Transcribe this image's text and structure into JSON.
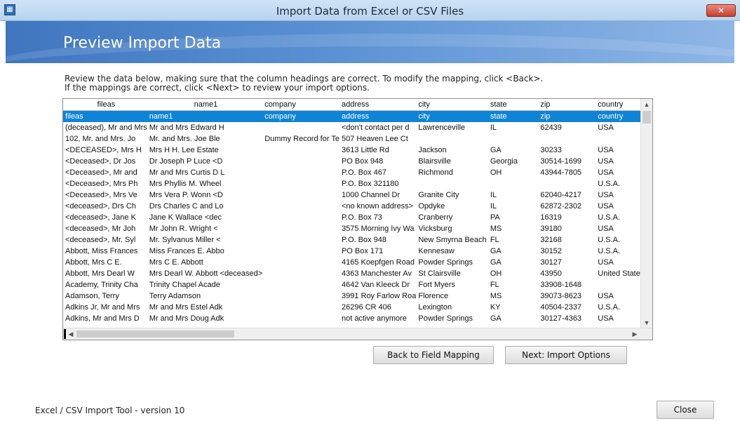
{
  "window": {
    "title": "Import Data from Excel or CSV Files",
    "close_symbol": "✕"
  },
  "banner": {
    "title": "Preview Import Data"
  },
  "instructions": {
    "line1": "Review the data below, making sure that the column headings are correct.  To modify the mapping, click <Back>.",
    "line2": "If the mappings are correct, click <Next> to review your import options."
  },
  "grid": {
    "headers": [
      "fileas",
      "name1",
      "company",
      "address",
      "city",
      "state",
      "zip",
      "country"
    ],
    "rows": [
      [
        "fileas",
        "name1",
        "company",
        "address",
        "city",
        "state",
        "zip",
        "country"
      ],
      [
        "(deceased), Mr and Mrs",
        "Mr and Mrs Edward H",
        "",
        "<don't contact per d",
        "Lawrenceville",
        "IL",
        "62439",
        "USA"
      ],
      [
        "102, Mr. and Mrs. Jo",
        "Mr. and Mrs. Joe Ble",
        "Dummy Record for Te",
        "507 Heaven Lee Ct",
        "",
        "",
        "",
        ""
      ],
      [
        "<DECEASED>, Mrs H",
        "Mrs H H. Lee Estate",
        "",
        "3613 Little Rd",
        "Jackson",
        "GA",
        "30233",
        "USA"
      ],
      [
        "<Deceased>, Dr Jos",
        "Dr Joseph P Luce <D",
        "",
        "PO Box 948",
        "Blairsville",
        "Georgia",
        "30514-1699",
        "USA"
      ],
      [
        "<Deceased>, Mr and",
        "Mr and Mrs Curtis D L",
        "",
        "P.O. Box 467",
        "Richmond",
        "OH",
        "43944-7805",
        "USA"
      ],
      [
        "<Deceased>, Mrs Ph",
        "Mrs Phyllis M. Wheel",
        "",
        "P.O. Box 321180",
        "",
        "",
        "",
        "U.S.A."
      ],
      [
        "<Deceased>, Mrs Ve",
        "Mrs Vera P. Wonn <D",
        "",
        "1000 Channel Dr",
        "Granite City",
        "IL",
        "62040-4217",
        "USA"
      ],
      [
        "<deceased>, Drs Ch",
        "Drs Charles C and Lo",
        "",
        "<no known address>",
        "Opdyke",
        "IL",
        "62872-2302",
        "USA"
      ],
      [
        "<deceased>, Jane K",
        "Jane K Wallace <dec",
        "",
        "P.O. Box 73",
        "Cranberry",
        "PA",
        "16319",
        "U.S.A."
      ],
      [
        "<deceased>, Mr Joh",
        "Mr John R. Wright <",
        "",
        "3575 Morning Ivy Wa",
        "Vicksburg",
        "MS",
        "39180",
        "USA"
      ],
      [
        "<deceased>, Mr. Syl",
        "Mr. Sylvanus Miller <",
        "",
        "P.O. Box 948",
        "New Smyrna Beach",
        "FL",
        "32168",
        "U.S.A."
      ],
      [
        "Abbott, Miss Frances",
        "Miss Frances E. Abbo",
        "",
        "PO Box 171",
        "Kennesaw",
        "GA",
        "30152",
        "U.S.A."
      ],
      [
        "Abbott, Mrs C E.",
        "Mrs C E. Abbott",
        "",
        "4165 Koepfgen Road",
        "Powder Springs",
        "GA",
        "30127",
        "USA"
      ],
      [
        "Abbott, Mrs Dearl W",
        "Mrs Dearl W. Abbott <deceased>",
        "",
        "4363 Manchester Av",
        "St Clairsville",
        "OH",
        "43950",
        "United States"
      ],
      [
        "Academy, Trinity Cha",
        "Trinity Chapel Acade",
        "",
        "4642 Van Kleeck Dr",
        "Fort Myers",
        "FL",
        "33908-1648",
        ""
      ],
      [
        "Adamson, Terry",
        "Terry Adamson",
        "",
        "3991 Roy Farlow Roa",
        "Florence",
        "MS",
        "39073-8623",
        "USA"
      ],
      [
        "Adkins Jr, Mr and Mrs",
        "Mr and Mrs Estel Adk",
        "",
        "26296 CR 406",
        "Lexington",
        "KY",
        "40504-2337",
        "U.S.A."
      ],
      [
        "Adkins, Mr and Mrs D",
        "Mr and Mrs Doug Adk",
        "",
        "not active anymore",
        "Powder Springs",
        "GA",
        "30127-4363",
        "USA"
      ]
    ]
  },
  "scroll": {
    "up": "▲",
    "down": "▼",
    "left": "◀",
    "right": "▶"
  },
  "buttons": {
    "back": "Back to Field Mapping",
    "next": "Next:  Import Options",
    "close": "Close"
  },
  "footer": {
    "version": "Excel / CSV Import Tool - version 10"
  }
}
